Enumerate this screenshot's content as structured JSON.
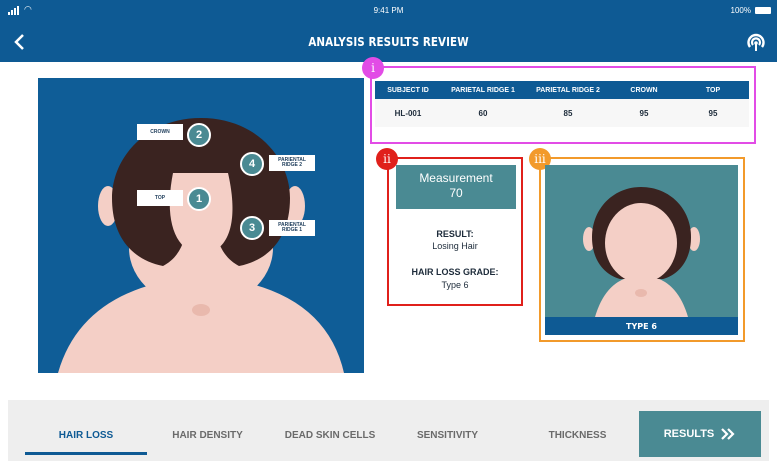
{
  "status_bar": {
    "time": "9:41 PM",
    "battery": "100%"
  },
  "header": {
    "title": "ANALYSIS RESULTS REVIEW",
    "back_icon": "chevron-left-icon",
    "sensor_icon": "sensor-signal-icon"
  },
  "head_map": {
    "points": [
      {
        "number": "2",
        "label": "CROWN"
      },
      {
        "number": "4",
        "label": "PARIENTAL\nRIDGE 2"
      },
      {
        "number": "1",
        "label": "TOP"
      },
      {
        "number": "3",
        "label": "PARIENTAL\nRIDGE 1"
      }
    ]
  },
  "markers": {
    "i": "i",
    "ii": "ii",
    "iii": "iii"
  },
  "table": {
    "headers": [
      "SUBJECT ID",
      "PARIETAL RIDGE 1",
      "PARIETAL RIDGE 2",
      "CROWN",
      "TOP"
    ],
    "row": [
      "HL-001",
      "60",
      "85",
      "95",
      "95"
    ]
  },
  "result": {
    "measurement_label": "Measurement",
    "measurement_value": "70",
    "result_label": "RESULT:",
    "result_value": "Losing Hair",
    "grade_label": "HAIR LOSS GRADE:",
    "grade_value": "Type 6"
  },
  "type_image": {
    "caption": "TYPE 6"
  },
  "tabs": [
    {
      "label": "HAIR LOSS",
      "active": true
    },
    {
      "label": "HAIR DENSITY",
      "active": false
    },
    {
      "label": "DEAD SKIN CELLS",
      "active": false
    },
    {
      "label": "SENSITIVITY",
      "active": false
    },
    {
      "label": "THICKNESS",
      "active": false
    }
  ],
  "results_button": {
    "label": "RESULTS",
    "icon": "double-chevron-right-icon"
  },
  "colors": {
    "header": "#0e5a94",
    "teal": "#4a8a93",
    "hair": "#3a2320",
    "skin": "#f4cfc6",
    "marker_i": "#e24ce6",
    "marker_ii": "#e0201b",
    "marker_iii": "#f29a2b"
  }
}
